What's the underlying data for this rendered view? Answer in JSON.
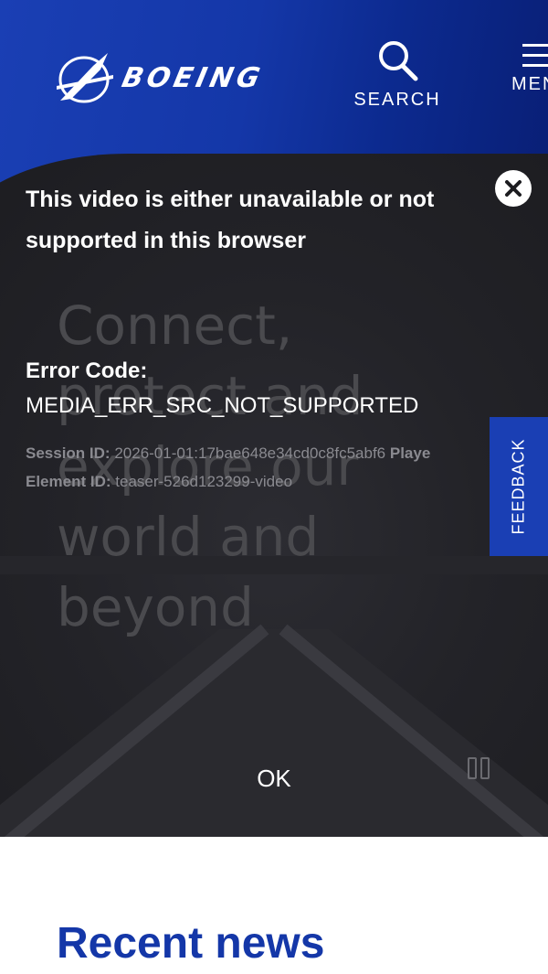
{
  "header": {
    "logo_text": "BOEING",
    "search_label": "SEARCH",
    "menu_label": "MENU"
  },
  "hero": {
    "headline_lines": [
      "Connect,",
      "protect and",
      "explore our",
      "world and",
      "beyond"
    ]
  },
  "video_error": {
    "title": "This video is either unavailable or not supported in this browser",
    "error_code_label": "Error Code:",
    "error_code": "MEDIA_ERR_SRC_NOT_SUPPORTED",
    "session_id_label": "Session ID:",
    "session_id": "2026-01-01:17bae648e34cd0c8fc5abf6",
    "player_label": "Playe",
    "element_id_label": "Element ID:",
    "element_id": "teaser-526d123299-video",
    "ok_label": "OK"
  },
  "feedback_label": "FEEDBACK",
  "recent_news_heading": "Recent news",
  "colors": {
    "brand_blue": "#1a3fb4",
    "dark_bg": "#232328",
    "heading_blue": "#1437a8"
  },
  "icons": [
    "boeing-logo-icon",
    "search-icon",
    "menu-icon",
    "close-icon",
    "pause-icon"
  ]
}
